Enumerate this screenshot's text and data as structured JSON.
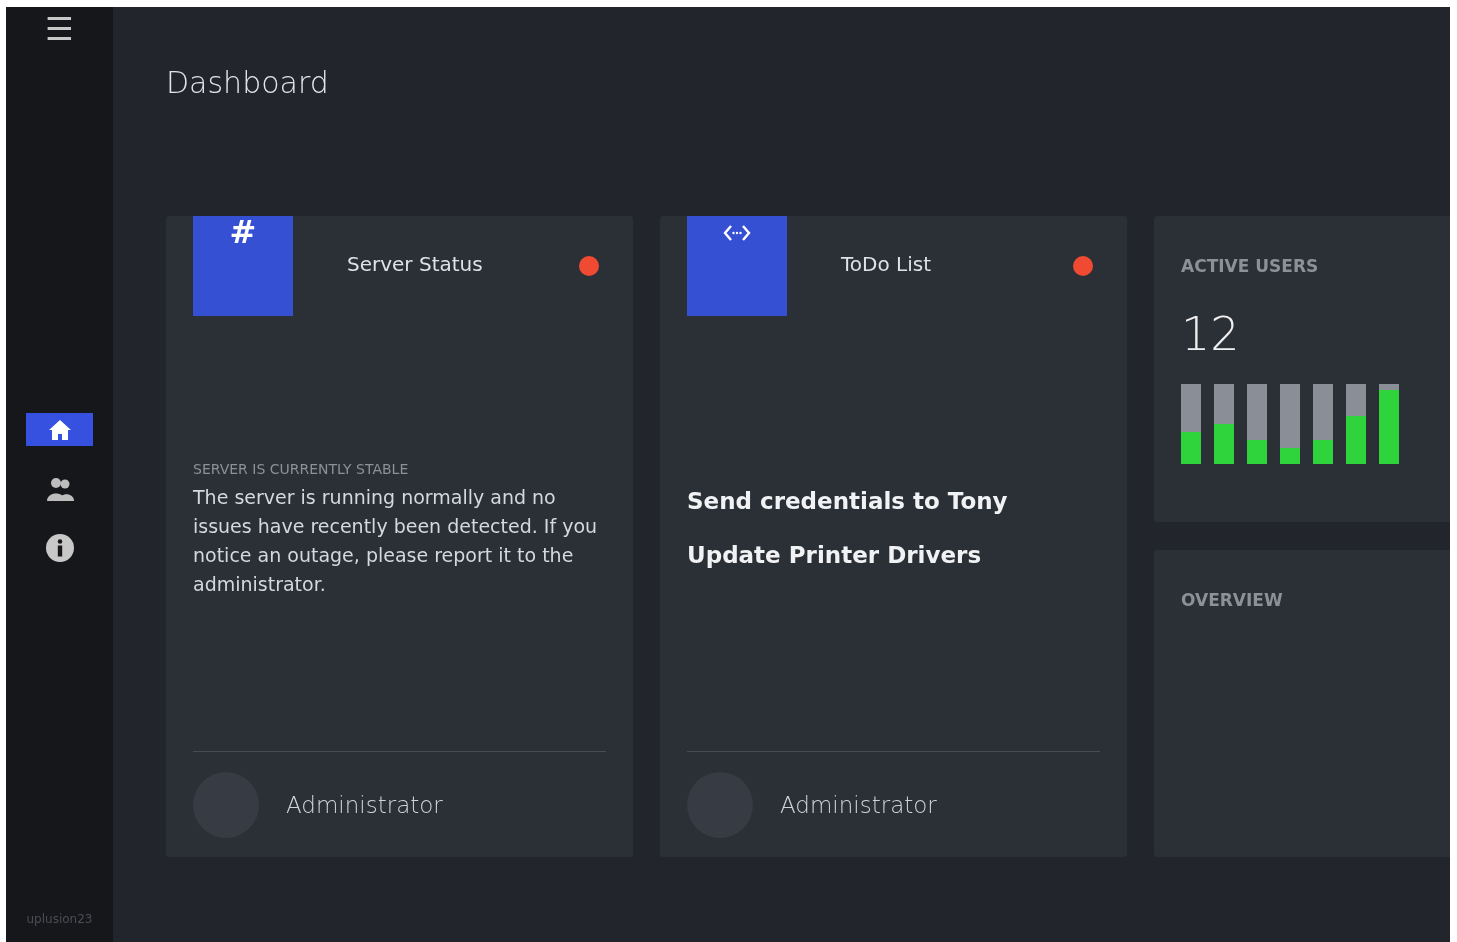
{
  "sidebar": {
    "menu": "☰",
    "items": [
      {
        "kind": "home",
        "selected": true
      },
      {
        "kind": "users",
        "selected": false
      },
      {
        "kind": "info",
        "selected": false
      }
    ],
    "footer": "uplusion23"
  },
  "page_title": "Dashboard",
  "cards": [
    {
      "icon": {
        "kind": "glyph",
        "text": "#"
      },
      "title": "Server Status",
      "color": "#f04a33",
      "body": {
        "kind": "text",
        "label": "SERVER IS CURRENTLY STABLE",
        "text": "The server is running normally and no issues have recently been detected. If you notice an outage, please report it to the administrator."
      },
      "author": "Administrator"
    },
    {
      "icon": {
        "kind": "code"
      },
      "title": "ToDo List",
      "color": "#f04a33",
      "body": {
        "kind": "list",
        "items": [
          "Send credentials to Tony",
          "Update Printer Drivers"
        ]
      },
      "author": "Administrator"
    }
  ],
  "active_users": {
    "label": "ACTIVE USERS",
    "count": "12",
    "bars": [
      {
        "level": 0.4
      },
      {
        "level": 0.5
      },
      {
        "level": 0.3
      },
      {
        "level": 0.2
      },
      {
        "level": 0.3
      },
      {
        "level": 0.6
      },
      {
        "level": 0.92
      }
    ]
  },
  "overview": {
    "label": "OVERVIEW"
  }
}
